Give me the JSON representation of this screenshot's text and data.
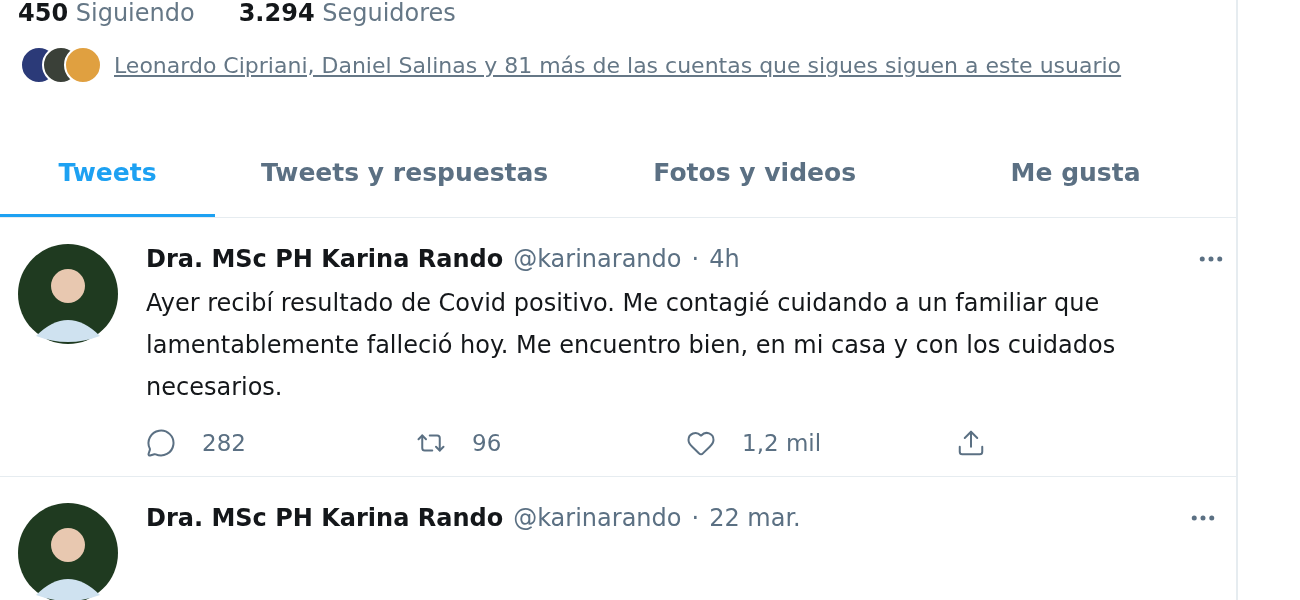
{
  "stats": [
    {
      "count": "450",
      "label": "Siguiendo"
    },
    {
      "count": "3.294",
      "label": "Seguidores"
    }
  ],
  "followed_by": {
    "avatars": [
      {
        "color": "#2b3a78"
      },
      {
        "color": "#3a4038"
      },
      {
        "color": "#e0a040"
      }
    ],
    "text": "Leonardo Cipriani, Daniel Salinas y 81 más de las cuentas que sigues siguen a este usuario"
  },
  "tabs": [
    {
      "label": "Tweets",
      "selected": true
    },
    {
      "label": "Tweets y respuestas",
      "selected": false
    },
    {
      "label": "Fotos y videos",
      "selected": false
    },
    {
      "label": "Me gusta",
      "selected": false
    }
  ],
  "tweets": [
    {
      "name": "Dra. MSc PH Karina Rando",
      "handle": "@karinarando",
      "separator": "·",
      "time": "4h",
      "text": "Ayer recibí resultado de Covid positivo. Me contagié cuidando a un familiar que lamentablemente falleció hoy. Me encuentro bien, en mi casa y con los cuidados necesarios.",
      "actions": [
        {
          "kind": "reply",
          "count": "282"
        },
        {
          "kind": "retweet",
          "count": "96"
        },
        {
          "kind": "like",
          "count": "1,2 mil"
        },
        {
          "kind": "share"
        }
      ]
    },
    {
      "name": "Dra. MSc PH Karina Rando",
      "handle": "@karinarando",
      "separator": "·",
      "time": "22 mar."
    }
  ]
}
